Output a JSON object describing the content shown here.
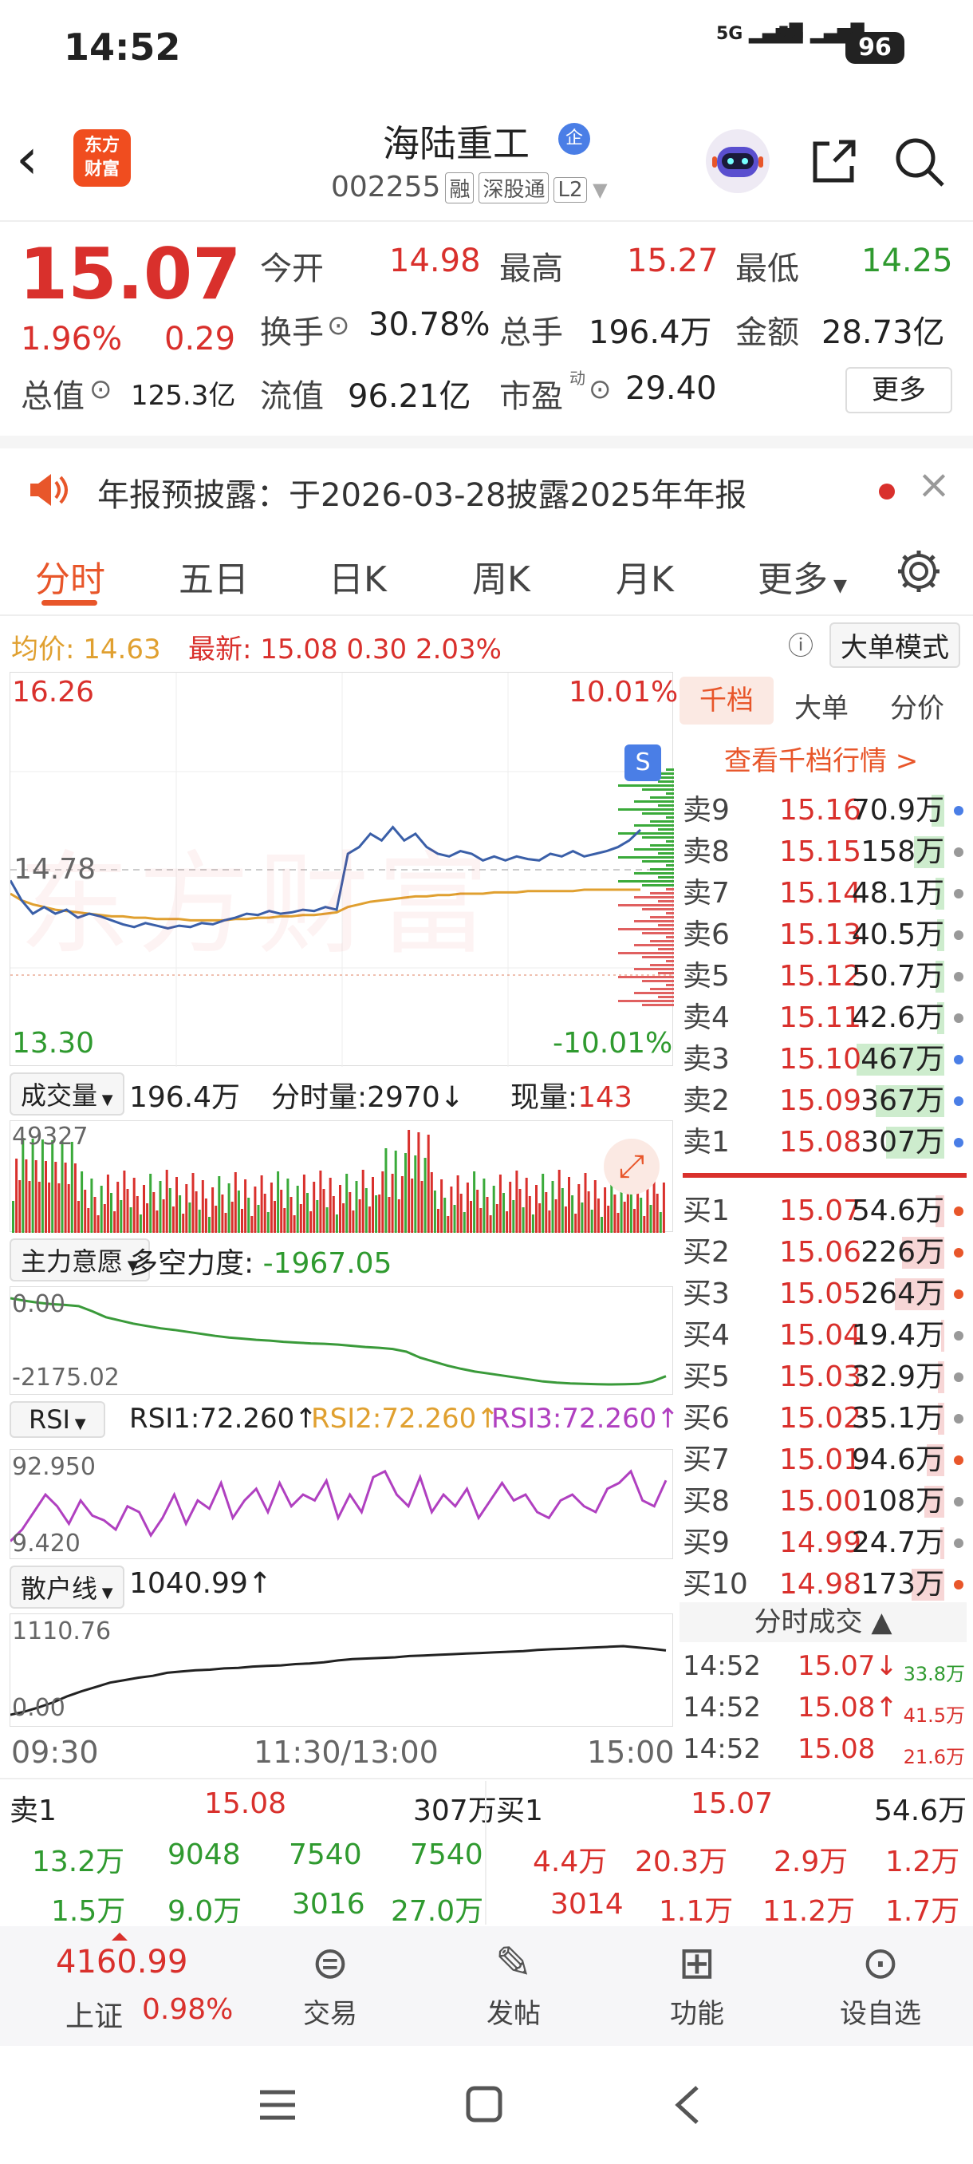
{
  "status_bar": {
    "time": "14:52",
    "signal_1": "5G",
    "signal_2": "5G",
    "battery": "96"
  },
  "header": {
    "logo_text_1": "东方",
    "logo_text_2": "财富",
    "title": "海陆重工",
    "reg_badge": "企",
    "code": "002255",
    "tags": [
      "融",
      "深股通",
      "L2"
    ]
  },
  "quote": {
    "price": "15.07",
    "pct": "1.96%",
    "chg": "0.29",
    "fields": {
      "open_label": "今开",
      "open": "14.98",
      "high_label": "最高",
      "high": "15.27",
      "low_label": "最低",
      "low": "14.25",
      "turnover_label": "换手",
      "turnover": "30.78%",
      "volume_label": "总手",
      "volume": "196.4万",
      "amount_label": "金额",
      "amount": "28.73亿",
      "mktcap_label": "总值",
      "mktcap": "125.3亿",
      "float_label": "流值",
      "float": "96.21亿",
      "pe_label": "市盈",
      "pe_sup": "动",
      "pe": "29.40"
    },
    "more_button": "更多"
  },
  "announcement": {
    "text": "年报预披露：于2026-03-28披露2025年年报"
  },
  "tabs": [
    "分时",
    "五日",
    "日K",
    "周K",
    "月K",
    "更多"
  ],
  "active_tab": "分时",
  "avg_line": {
    "avg_label": "均价:",
    "avg": "14.63",
    "last_label": "最新:",
    "last": "15.08",
    "chg": "0.30",
    "pct": "2.03%",
    "mode_button": "大单模式"
  },
  "chart_main": {
    "top_price": "16.26",
    "top_pct": "10.01%",
    "mid_price": "14.78",
    "bottom_price": "13.30",
    "bottom_pct": "-10.01%",
    "watermark": "东方财富"
  },
  "volume_panel": {
    "selector": "成交量",
    "total": "196.4万",
    "tick_label": "分时量:",
    "tick_value": "2970",
    "tick_arrow": "↓",
    "now_label": "现量:",
    "now_value": "143",
    "max_label": "49327"
  },
  "main_force": {
    "selector": "主力意愿",
    "label": "多空力度:",
    "value": "-1967.05",
    "top": "0.00",
    "bottom": "-2175.02"
  },
  "rsi": {
    "selector": "RSI",
    "rsi1_label": "RSI1:",
    "rsi1": "72.260",
    "rsi2_label": "RSI2:",
    "rsi2": "72.260",
    "rsi3_label": "RSI3:",
    "rsi3": "72.260",
    "arrow": "↑",
    "top": "92.950",
    "bottom": "9.420"
  },
  "retail": {
    "selector": "散户线",
    "value": "1040.99",
    "arrow": "↑",
    "top": "1110.76",
    "bottom": "0.00"
  },
  "time_axis": [
    "09:30",
    "11:30/13:00",
    "15:00"
  ],
  "side_tabs": [
    "千档",
    "大单",
    "分价"
  ],
  "side_link": "查看千档行情 >",
  "sells": [
    {
      "k": "卖9",
      "p": "15.16",
      "v": "70.9万",
      "dot": "#4a7ee6",
      "bar": 0.15
    },
    {
      "k": "卖8",
      "p": "15.15",
      "v": "158万",
      "dot": "#999999",
      "bar": 0.35
    },
    {
      "k": "卖7",
      "p": "15.14",
      "v": "48.1万",
      "dot": "#999999",
      "bar": 0.1
    },
    {
      "k": "卖6",
      "p": "15.13",
      "v": "40.5万",
      "dot": "#999999",
      "bar": 0.08
    },
    {
      "k": "卖5",
      "p": "15.12",
      "v": "50.7万",
      "dot": "#999999",
      "bar": 0.1
    },
    {
      "k": "卖4",
      "p": "15.11",
      "v": "42.6万",
      "dot": "#999999",
      "bar": 0.08
    },
    {
      "k": "卖3",
      "p": "15.10",
      "v": "467万",
      "dot": "#4a7ee6",
      "bar": 1.0
    },
    {
      "k": "卖2",
      "p": "15.09",
      "v": "367万",
      "dot": "#4a7ee6",
      "bar": 0.78
    },
    {
      "k": "卖1",
      "p": "15.08",
      "v": "307万",
      "dot": "#4a7ee6",
      "bar": 0.66
    }
  ],
  "buys": [
    {
      "k": "买1",
      "p": "15.07",
      "v": "54.6万",
      "dot": "#e8562a",
      "bar": 0.1
    },
    {
      "k": "买2",
      "p": "15.06",
      "v": "226万",
      "dot": "#e8562a",
      "bar": 0.48
    },
    {
      "k": "买3",
      "p": "15.05",
      "v": "264万",
      "dot": "#e8562a",
      "bar": 0.56
    },
    {
      "k": "买4",
      "p": "15.04",
      "v": "19.4万",
      "dot": "#999999",
      "bar": 0.04
    },
    {
      "k": "买5",
      "p": "15.03",
      "v": "32.9万",
      "dot": "#999999",
      "bar": 0.07
    },
    {
      "k": "买6",
      "p": "15.02",
      "v": "35.1万",
      "dot": "#999999",
      "bar": 0.07
    },
    {
      "k": "买7",
      "p": "15.01",
      "v": "94.6万",
      "dot": "#e8562a",
      "bar": 0.2
    },
    {
      "k": "买8",
      "p": "15.00",
      "v": "108万",
      "dot": "#999999",
      "bar": 0.23
    },
    {
      "k": "买9",
      "p": "14.99",
      "v": "24.7万",
      "dot": "#999999",
      "bar": 0.05
    },
    {
      "k": "买10",
      "p": "14.98",
      "v": "173万",
      "dot": "#e8562a",
      "bar": 0.37
    }
  ],
  "trades_header": "分时成交",
  "trades": [
    {
      "t": "14:52",
      "p": "15.07",
      "arr": "↓",
      "v": "33.8万",
      "pc": "#d9302c",
      "vc": "#2f9a2f"
    },
    {
      "t": "14:52",
      "p": "15.08",
      "arr": "↑",
      "v": "41.5万",
      "pc": "#d9302c",
      "vc": "#d9302c"
    },
    {
      "t": "14:52",
      "p": "15.08",
      "arr": "",
      "v": "21.6万",
      "pc": "#d9302c",
      "vc": "#d9302c"
    }
  ],
  "bottom_book": {
    "sell_label": "卖1",
    "sell_price": "15.08",
    "sell_vol": "307万",
    "buy_label": "买1",
    "buy_price": "15.07",
    "buy_vol": "54.6万",
    "sell_row1": [
      "13.2万",
      "9048",
      "7540",
      "7540"
    ],
    "sell_row2": [
      "1.5万",
      "9.0万",
      "3016",
      "27.0万"
    ],
    "buy_row1": [
      "4.4万",
      "20.3万",
      "2.9万",
      "1.2万"
    ],
    "buy_row2": [
      "3014",
      "1.1万",
      "11.2万",
      "1.7万"
    ]
  },
  "nav": {
    "index_value": "4160.99",
    "index_name": "上证",
    "index_pct": "0.98%",
    "items": [
      "交易",
      "发帖",
      "功能",
      "设自选"
    ]
  },
  "colors": {
    "up": "#d9302c",
    "down": "#2f9a2f",
    "accent": "#e8562a",
    "price_line": "#3a5fa8",
    "avg_line": "#e0a030"
  },
  "chart_data": [
    {
      "type": "line",
      "title": "分时",
      "series": [
        {
          "name": "最新",
          "values": [
            14.7,
            14.55,
            14.45,
            14.5,
            14.45,
            14.48,
            14.42,
            14.45,
            14.43,
            14.4,
            14.37,
            14.35,
            14.38,
            14.36,
            14.34,
            14.36,
            14.35,
            14.38,
            14.37,
            14.4,
            14.42,
            14.45,
            14.44,
            14.47,
            14.45,
            14.46,
            14.48,
            14.47,
            14.5,
            14.48,
            14.9,
            14.95,
            15.05,
            15.0,
            15.1,
            15.0,
            15.05,
            14.95,
            14.9,
            14.88,
            14.92,
            14.9,
            14.85,
            14.88,
            14.85,
            14.88,
            14.86,
            14.85,
            14.9,
            14.88,
            14.92,
            14.88,
            14.9,
            14.92,
            14.95,
            15.0,
            15.08
          ]
        },
        {
          "name": "均价",
          "values": [
            14.6,
            14.55,
            14.52,
            14.5,
            14.48,
            14.47,
            14.46,
            14.45,
            14.44,
            14.43,
            14.43,
            14.42,
            14.42,
            14.41,
            14.41,
            14.41,
            14.4,
            14.4,
            14.4,
            14.4,
            14.41,
            14.41,
            14.42,
            14.42,
            14.43,
            14.43,
            14.44,
            14.44,
            14.45,
            14.46,
            14.5,
            14.52,
            14.54,
            14.55,
            14.56,
            14.57,
            14.58,
            14.58,
            14.59,
            14.59,
            14.6,
            14.6,
            14.6,
            14.61,
            14.61,
            14.61,
            14.62,
            14.62,
            14.62,
            14.62,
            14.62,
            14.63,
            14.63,
            14.63,
            14.63,
            14.63,
            14.63
          ]
        }
      ],
      "ylim": [
        13.3,
        16.26
      ]
    },
    {
      "type": "line",
      "title": "主力意愿",
      "series": [
        {
          "name": "多空力度",
          "values": [
            0,
            -60,
            -110,
            -150,
            -170,
            -200,
            -330,
            -480,
            -560,
            -640,
            -700,
            -760,
            -800,
            -850,
            -900,
            -950,
            -990,
            -1020,
            -1050,
            -1070,
            -1100,
            -1120,
            -1140,
            -1150,
            -1170,
            -1200,
            -1230,
            -1250,
            -1280,
            -1350,
            -1500,
            -1600,
            -1700,
            -1780,
            -1850,
            -1900,
            -1950,
            -2000,
            -2050,
            -2100,
            -2130,
            -2150,
            -2160,
            -2170,
            -2175,
            -2170,
            -2160,
            -2100,
            -1967.05
          ]
        }
      ],
      "ylim": [
        -2175.02,
        0
      ]
    },
    {
      "type": "line",
      "title": "RSI",
      "series": [
        {
          "name": "RSI1",
          "values": [
            20,
            30,
            45,
            60,
            50,
            35,
            55,
            42,
            38,
            30,
            50,
            45,
            25,
            40,
            60,
            35,
            55,
            48,
            70,
            40,
            55,
            65,
            45,
            70,
            50,
            60,
            55,
            72,
            40,
            60,
            45,
            75,
            80,
            60,
            50,
            75,
            45,
            60,
            50,
            65,
            40,
            55,
            70,
            55,
            60,
            45,
            40,
            55,
            60,
            50,
            45,
            65,
            70,
            80,
            55,
            50,
            72.26
          ]
        }
      ],
      "ylim": [
        9.42,
        92.95
      ]
    },
    {
      "type": "line",
      "title": "散户线",
      "series": [
        {
          "name": "散户线",
          "values": [
            0,
            50,
            120,
            200,
            300,
            380,
            450,
            520,
            560,
            600,
            630,
            680,
            700,
            720,
            730,
            750,
            760,
            780,
            790,
            800,
            820,
            830,
            850,
            880,
            900,
            910,
            920,
            930,
            950,
            960,
            970,
            980,
            990,
            1000,
            1010,
            1020,
            1030,
            1050,
            1060,
            1070,
            1080,
            1090,
            1100,
            1110.76,
            1090,
            1070,
            1040.99
          ]
        }
      ],
      "ylim": [
        0,
        1110.76
      ]
    }
  ]
}
